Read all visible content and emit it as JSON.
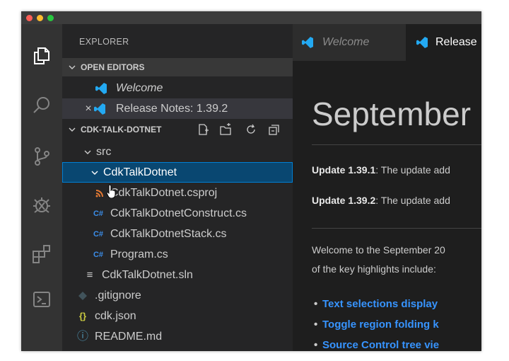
{
  "explorer": {
    "title": "EXPLORER",
    "open_editors_label": "OPEN EDITORS",
    "open_editors": [
      {
        "label": "Welcome",
        "icon": "vscode-logo-icon"
      },
      {
        "label": "Release Notes: 1.39.2",
        "icon": "vscode-logo-icon"
      }
    ],
    "project_label": "CDK-TALK-DOTNET",
    "tree": [
      {
        "label": "src",
        "icon": "chevron-down-icon"
      },
      {
        "label": "CdkTalkDotnet",
        "icon": "chevron-down-icon"
      },
      {
        "label": "CdkTalkDotnet.csproj",
        "icon": "rss-icon"
      },
      {
        "label": "CdkTalkDotnetConstruct.cs",
        "icon": "csharp-icon"
      },
      {
        "label": "CdkTalkDotnetStack.cs",
        "icon": "csharp-icon"
      },
      {
        "label": "Program.cs",
        "icon": "csharp-icon"
      },
      {
        "label": "CdkTalkDotnet.sln",
        "icon": "lines-icon"
      },
      {
        "label": ".gitignore",
        "icon": "diamond-icon"
      },
      {
        "label": "cdk.json",
        "icon": "braces-icon"
      },
      {
        "label": "README.md",
        "icon": "info-icon"
      }
    ],
    "icons": {
      "braces": "{}",
      "info": "ⓘ",
      "csharp": "C#",
      "lines": "≡",
      "close": "×"
    }
  },
  "tabs": [
    {
      "label": "Welcome",
      "active": false
    },
    {
      "label": "Release",
      "active": true
    }
  ],
  "editor": {
    "heading": "September",
    "update1_bold": "Update 1.39.1",
    "update1_rest": ": The update add",
    "update2_bold": "Update 1.39.2",
    "update2_rest": ": The update add",
    "welcome_line1": "Welcome to the September 20",
    "welcome_line2": "of the key highlights include:",
    "bullets": [
      "Text selections display",
      "Toggle region folding k",
      "Source Control tree vie"
    ]
  },
  "colors": {
    "accent_selection": "#094771",
    "link": "#3794ff",
    "vscode_blue": "#23a9f2",
    "csharp": "#3b8eea",
    "rss": "#e37933"
  }
}
